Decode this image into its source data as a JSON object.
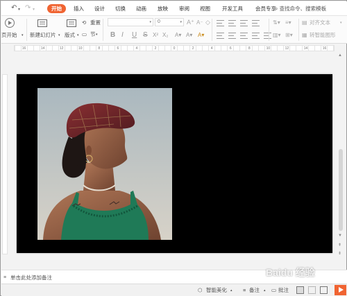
{
  "menu": {
    "tabs": [
      "开始",
      "插入",
      "设计",
      "切换",
      "动画",
      "放映",
      "审阅",
      "视图",
      "开发工具",
      "会员专享"
    ],
    "search_label": "查找命令、搜索模板",
    "quick_access": {
      "undo": "↶",
      "redo": "↷"
    }
  },
  "ribbon": {
    "from_page": "从当前开始",
    "from_page_visible": "页开始",
    "new_slide": "新建幻灯片",
    "layout": "版式",
    "section": "节",
    "reset": "重置",
    "font_size": "0",
    "increase_font": "A⁺",
    "decrease_font": "A⁻",
    "bold": "B",
    "italic": "I",
    "underline": "U",
    "strike": "S",
    "align_text": "对齐文本",
    "smart_graphic": "转智能图形"
  },
  "ruler": {
    "labels": [
      "16",
      "14",
      "12",
      "10",
      "8",
      "6",
      "4",
      "2",
      "0",
      "2",
      "4",
      "6",
      "8",
      "10",
      "12",
      "14",
      "16"
    ]
  },
  "notes": {
    "placeholder": "单击此处添加备注"
  },
  "status": {
    "smart_beautify": "智能美化",
    "notes": "备注",
    "comments": "批注"
  },
  "watermark": {
    "text": "Baidu 经验"
  },
  "colors": {
    "accent": "#f06432",
    "slide_bg": "#000000"
  }
}
